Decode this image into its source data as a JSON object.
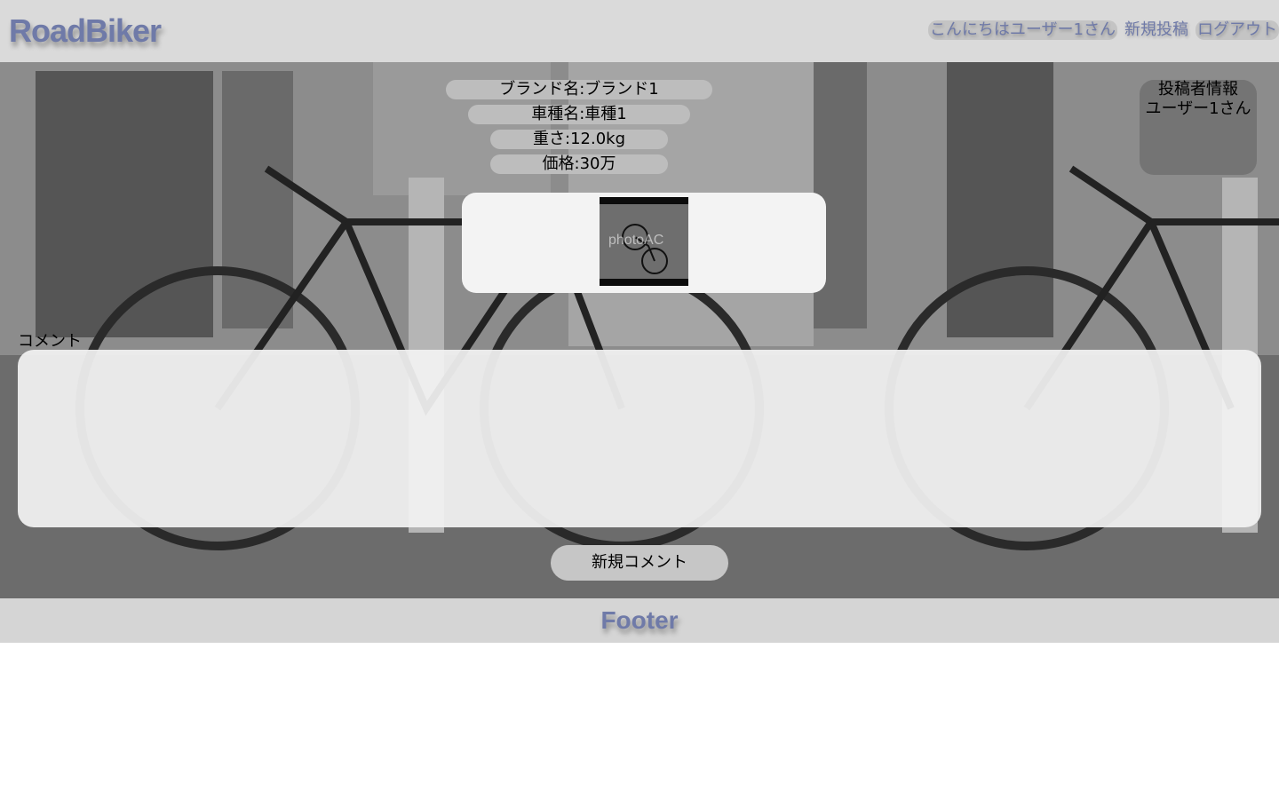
{
  "header": {
    "logo": "RoadBiker",
    "nav": {
      "greeting": "こんにちはユーザー1さん",
      "new_post": "新規投稿",
      "logout": "ログアウト"
    }
  },
  "post": {
    "brand": "ブランド名:ブランド1",
    "model": "車種名:車種1",
    "weight": "重さ:12.0kg",
    "price": "価格:30万",
    "image_watermark": "photoAC"
  },
  "poster": {
    "heading": "投稿者情報",
    "name": "ユーザー1さん"
  },
  "comments": {
    "label": "コメント",
    "new_comment_button": "新規コメント"
  },
  "footer": {
    "text": "Footer"
  },
  "colors": {
    "brand": "#6f7aa8",
    "header_bg": "#dadada",
    "pill_bg": "#bdbdbd"
  }
}
